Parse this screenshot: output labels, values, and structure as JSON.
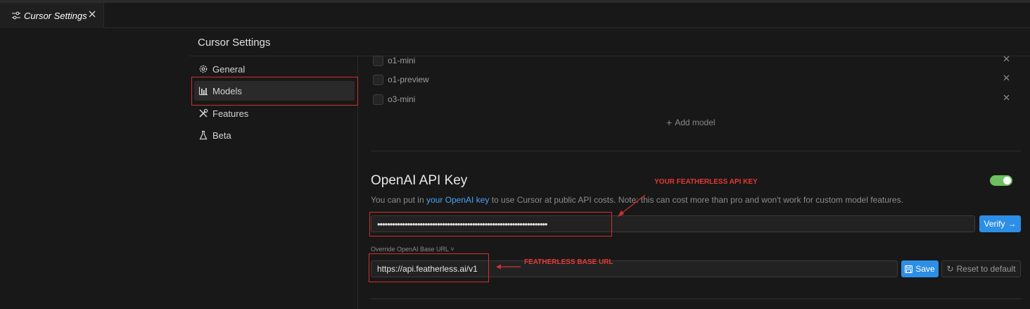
{
  "tab": {
    "title": "Cursor Settings",
    "icon": "settings-sliders-icon",
    "close_icon": "close-icon"
  },
  "settings": {
    "title": "Cursor Settings"
  },
  "sidebar": {
    "items": [
      {
        "label": "General",
        "icon": "gear-icon"
      },
      {
        "label": "Models",
        "icon": "bar-chart-icon",
        "active": true
      },
      {
        "label": "Features",
        "icon": "tools-icon"
      },
      {
        "label": "Beta",
        "icon": "flask-icon"
      }
    ]
  },
  "models": {
    "items": [
      {
        "name": "o1-mini",
        "checked": false
      },
      {
        "name": "o1-preview",
        "checked": false
      },
      {
        "name": "o3-mini",
        "checked": false
      }
    ],
    "add_label": "Add model"
  },
  "openai": {
    "heading": "OpenAI API Key",
    "toggle_on": true,
    "desc_before": "You can put in ",
    "desc_link": "your OpenAI key",
    "desc_after": " to use Cursor at public API costs. Note: this can cost more than pro and won't work for custom model features.",
    "api_key_masked": "••••••••••••••••••••••••••••••••••••••••••••••••••••••••••••••••••••",
    "verify_label": "Verify",
    "override_label": "Override OpenAI Base URL",
    "base_url": "https://api.featherless.ai/v1",
    "save_label": "Save",
    "reset_label": "Reset to default"
  },
  "annotations": {
    "api_key_label": "YOUR FEATHERLESS API KEY",
    "base_url_label": "FEATHERLESS BASE URL",
    "color": "#e53935"
  },
  "colors": {
    "accent": "#2d8ee6",
    "toggle": "#6ebf61",
    "link": "#4aa3f0",
    "annotation": "#d32f2f"
  }
}
